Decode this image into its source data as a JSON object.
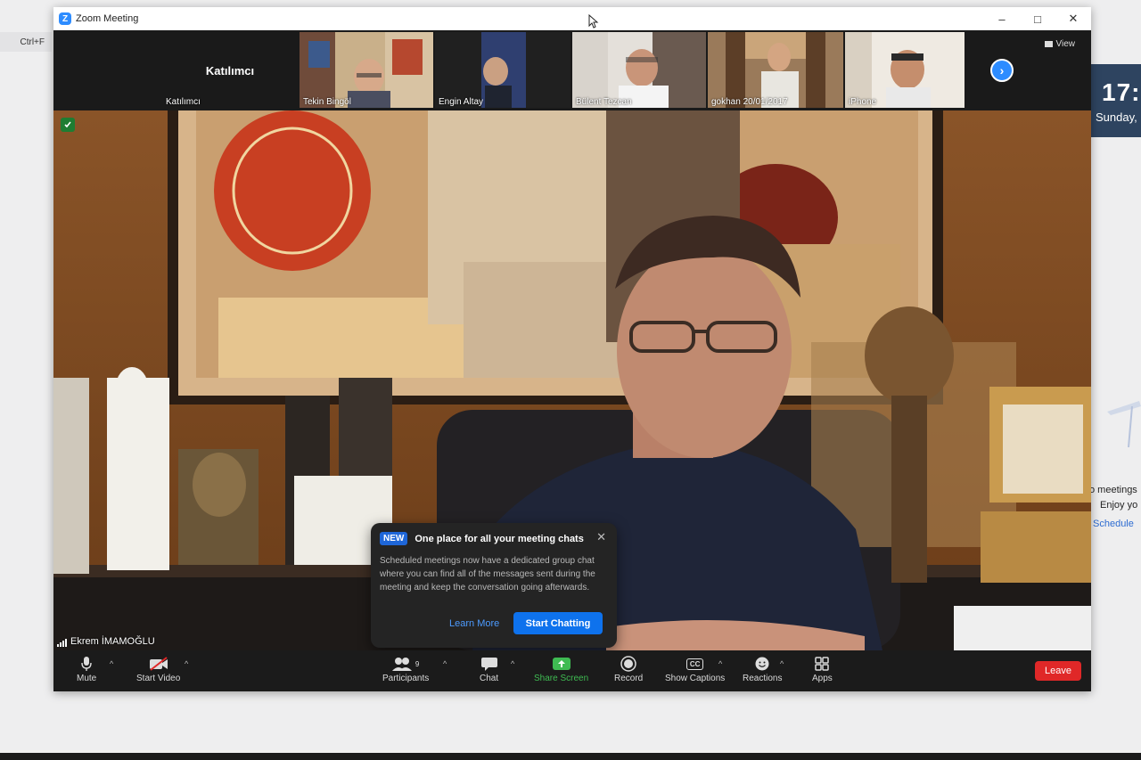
{
  "desktop": {
    "shortcut_hint": "Ctrl+F",
    "clock_time": "17:",
    "clock_day": "Sunday,",
    "side_texts": [
      "o meetings",
      "Enjoy yo",
      "Schedule"
    ]
  },
  "window": {
    "title": "Zoom Meeting",
    "app_icon": "zoom-logo",
    "controls": [
      "–",
      "□",
      "✕"
    ]
  },
  "gallery": {
    "tiles": [
      {
        "name": "Katılımcı",
        "center_label": "Katılımcı"
      },
      {
        "name": "Tekin Bingöl"
      },
      {
        "name": "Engin Altay"
      },
      {
        "name": "Bülent Tezcan"
      },
      {
        "name": "gokhan 20/01/2017"
      },
      {
        "name": "iPhone"
      }
    ],
    "view_label": "View",
    "next_icon": "chevron-right-icon"
  },
  "main_video": {
    "speaker_name": "Ekrem İMAMOĞLU"
  },
  "popup": {
    "badge": "NEW",
    "title": "One place for all your meeting chats",
    "body": "Scheduled meetings now have a dedicated group chat where you can find all of the messages sent during the meeting and keep the conversation going afterwards.",
    "learn_more": "Learn More",
    "start_chatting": "Start Chatting"
  },
  "toolbar": {
    "mute": "Mute",
    "start_video": "Start Video",
    "participants": "Participants",
    "participants_count": "9",
    "chat": "Chat",
    "share_screen": "Share Screen",
    "record": "Record",
    "show_captions": "Show Captions",
    "captions_icon_text": "CC",
    "reactions": "Reactions",
    "apps": "Apps",
    "leave": "Leave"
  },
  "colors": {
    "accent": "#2d8cff",
    "leave": "#e02828",
    "share_green": "#3fbb52"
  }
}
